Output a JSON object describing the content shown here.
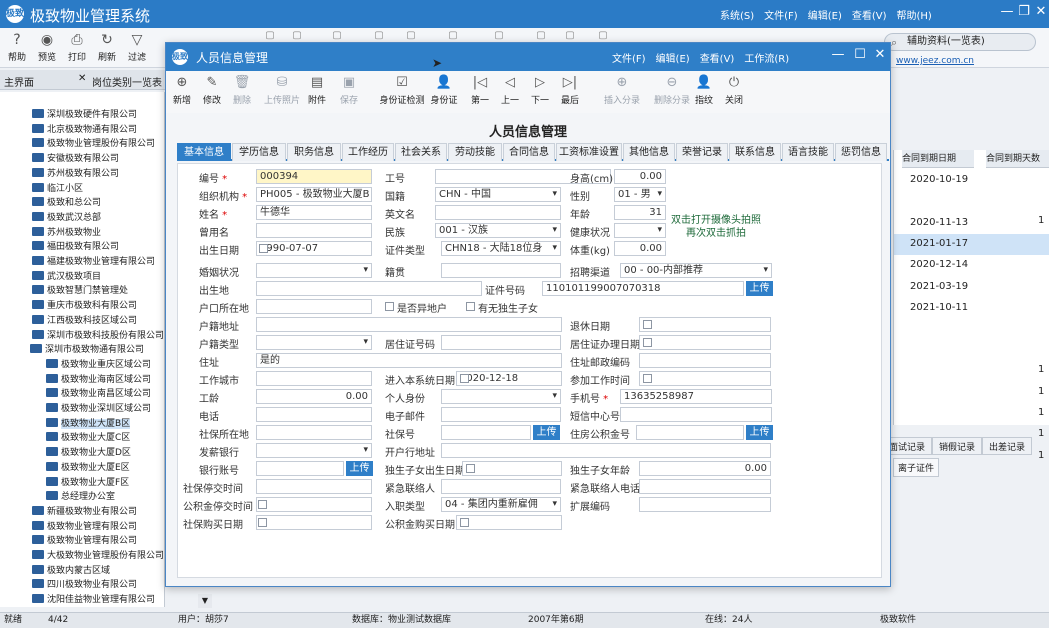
{
  "app": {
    "title": "极致物业管理系统",
    "logo": "极致",
    "menus": [
      "系统(S)",
      "文件(F)",
      "编辑(E)",
      "查看(V)",
      "帮助(H)"
    ]
  },
  "main_toolbar": [
    {
      "label": "帮助",
      "icon": "?"
    },
    {
      "label": "预览",
      "icon": "◉"
    },
    {
      "label": "打印",
      "icon": "⎙"
    },
    {
      "label": "刷新",
      "icon": "↻"
    },
    {
      "label": "过滤",
      "icon": "▽"
    }
  ],
  "search": {
    "placeholder": "辅助资料(一览表)"
  },
  "site_link": "www.jeez.com.cn",
  "tabs": {
    "main": "主界面",
    "other": "岗位类别一览表"
  },
  "tree": [
    "深圳极致硬件有限公司",
    "北京极致物通有限公司",
    "极致物业管理股份有限公司",
    "安徽极致有限公司",
    "苏州极致有限公司",
    "临江小区",
    "极致和总公司",
    "极致武汉总部",
    "苏州极致物业",
    "福田极致有限公司",
    "福建极致物业管理有限公司",
    "武汉极致项目",
    "极致智慧门禁管理处",
    "重庆市极致科有限公司",
    "江西极致科技区域公司",
    "深圳市极致科技股份有限公司",
    "深圳市极致物通有限公司",
    "极致物业重庆区域公司",
    "极致物业海南区域公司",
    "极致物业南昌区域公司",
    "极致物业深圳区域公司",
    "极致物业大厦B区",
    "极致物业大厦C区",
    "极致物业大厦D区",
    "极致物业大厦E区",
    "极致物业大厦F区",
    "总经理办公室",
    "新疆极致物业有限公司",
    "极致物业管理有限公司",
    "极致物业管理有限公司",
    "大极致物业管理股份有限公司",
    "极致内蒙古区域",
    "四川极致物业有限公司",
    "沈阳佳益物业管理有限公司"
  ],
  "bg_grid": {
    "col1": "合同到期日期",
    "col2": "合同到期天数",
    "dates": [
      "2020-10-19",
      "",
      "2020-11-13",
      "2021-01-17",
      "2020-12-14",
      "2021-03-19",
      "2021-10-11"
    ],
    "nums": [
      "",
      "1",
      "",
      "",
      "",
      "",
      "",
      "",
      "1",
      "1",
      "1",
      "1",
      "1"
    ]
  },
  "bg_tabs": [
    "面试记录",
    "销假记录",
    "出差记录"
  ],
  "bg_sub": "离子证件",
  "status": {
    "ready": "就绪",
    "record": "4/42",
    "user": "用户：胡莎7",
    "db": "数据库：物业测试数据库",
    "period": "2007年第6期",
    "online": "在线：24人",
    "company": "极致软件"
  },
  "dialog": {
    "title": "人员信息管理",
    "logo": "极致",
    "menus": [
      "文件(F)",
      "编辑(E)",
      "查看(V)",
      "工作流(R)"
    ],
    "toolbar": [
      {
        "label": "新增",
        "icon": "⊕"
      },
      {
        "label": "修改",
        "icon": "✎"
      },
      {
        "label": "删除",
        "icon": "🗑",
        "dis": true
      },
      {
        "label": "上传照片",
        "icon": "⛁",
        "dis": true
      },
      {
        "label": "附件",
        "icon": "▤"
      },
      {
        "label": "保存",
        "icon": "▣",
        "dis": true
      },
      {
        "label": "身份证检测",
        "icon": "☑"
      },
      {
        "label": "身份证",
        "icon": "👤"
      },
      {
        "label": "第一",
        "icon": "|◁"
      },
      {
        "label": "上一",
        "icon": "◁"
      },
      {
        "label": "下一",
        "icon": "▷"
      },
      {
        "label": "最后",
        "icon": "▷|"
      },
      {
        "label": "插入分录",
        "icon": "⊕",
        "dis": true
      },
      {
        "label": "删除分录",
        "icon": "⊖",
        "dis": true
      },
      {
        "label": "指纹",
        "icon": "👤"
      },
      {
        "label": "关闭",
        "icon": "⏻"
      }
    ],
    "form_title": "人员信息管理",
    "tabs": [
      "基本信息",
      "学历信息",
      "职务信息",
      "工作经历",
      "社会关系",
      "劳动技能",
      "合同信息",
      "工资标准设置",
      "其他信息",
      "荣誉记录",
      "联系信息",
      "语言技能",
      "惩罚信息"
    ],
    "labels": {
      "emp_no": "编号",
      "org": "组织机构",
      "name": "姓名",
      "used_name": "曾用名",
      "birth": "出生日期",
      "marital": "婚姻状况",
      "birthplace": "出生地",
      "hukou": "户口所在地",
      "huji_addr": "户籍地址",
      "huji_type": "户籍类型",
      "address": "住址",
      "work_city": "工作城市",
      "seniority": "工龄",
      "phone": "电话",
      "social_place": "社保所在地",
      "pay_bank": "发薪银行",
      "bank_acct": "银行账号",
      "social_stop": "社保停交时间",
      "fund_stop": "公积金停交时间",
      "social_buy": "社保购买日期",
      "work_no": "工号",
      "nationality": "国籍",
      "en_name": "英文名",
      "ethnic": "民族",
      "id_type": "证件类型",
      "native": "籍贯",
      "id_no": "证件号码",
      "remote": "是否异地户",
      "only_child": "有无独生子女",
      "residence_no": "居住证号码",
      "enter_date": "进入本系统日期",
      "identity": "个人身份",
      "email": "电子邮件",
      "social_no": "社保号",
      "bank_addr": "开户行地址",
      "child_birth": "独生子女出生日期",
      "emergency": "紧急联络人",
      "hire_type": "入职类型",
      "fund_buy": "公积金购买日期",
      "height": "身高(cm)",
      "gender": "性别",
      "age": "年龄",
      "health": "健康状况",
      "weight": "体重(kg)",
      "recruit": "招聘渠道",
      "retire": "退休日期",
      "residence_date": "居住证办理日期",
      "postcode": "住址邮政编码",
      "join_work": "参加工作时间",
      "mobile": "手机号",
      "sms": "短信中心号",
      "housing_fund": "住房公积金号",
      "child_age": "独生子女年龄",
      "emergency_phone": "紧急联络人电话",
      "ext_code": "扩展编码"
    },
    "values": {
      "emp_no": "000394",
      "org": "PH005 - 极致物业大厦B",
      "name": "牛德华",
      "birth": "1990-07-07",
      "address": "是的",
      "seniority": "0.00",
      "nationality": "CHN - 中国",
      "ethnic": "001 - 汉族",
      "id_type": "CHN18 - 大陆18位身",
      "id_no": "110101199007070318",
      "enter_date": "2020-12-18",
      "hire_type": "04 - 集团内重新雇佣",
      "height": "0.00",
      "gender": "01 - 男",
      "age": "31",
      "weight": "0.00",
      "recruit": "00 - 00-内部推荐",
      "mobile": "13635258987",
      "child_age": "0.00"
    },
    "upload": "上传",
    "camera_hint": "双击打开摄像头拍照 再次双击抓拍"
  }
}
